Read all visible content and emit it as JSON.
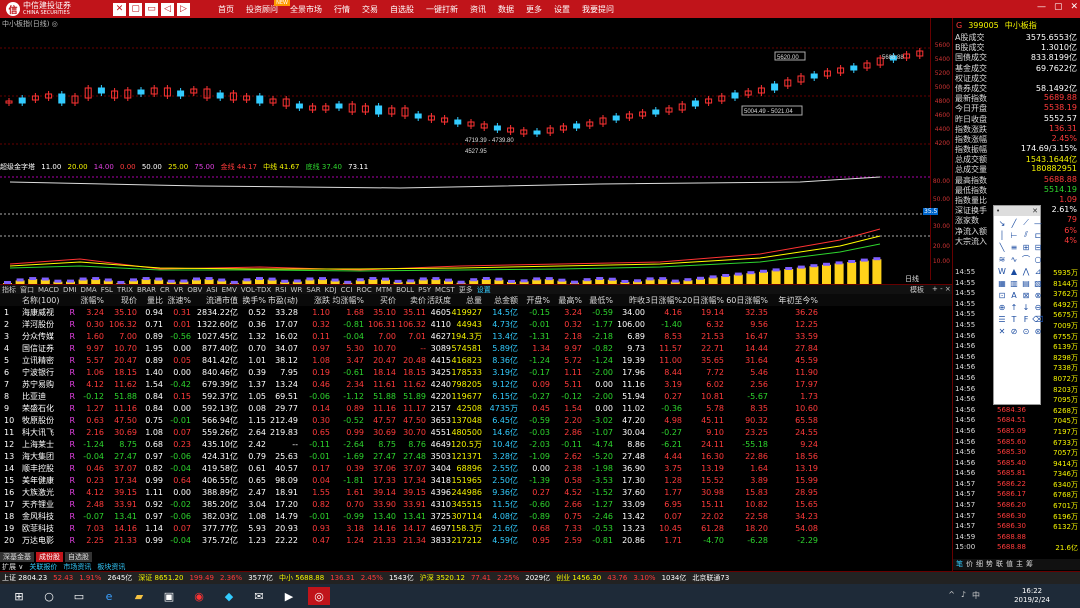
{
  "titlebar": {
    "logo_name": "中信建投证券",
    "logo_sub": "CHINA SECURITIES",
    "win_buttons": [
      "✕",
      "▢",
      "▭",
      "◁",
      "▷"
    ],
    "menu": [
      "首页",
      "投资顾问",
      "全景市场",
      "行情",
      "交易",
      "自选股",
      "一键打新",
      "资讯",
      "数据",
      "更多",
      "设置",
      "我要提问"
    ],
    "menu_new_badge": "NEW",
    "win_ctl": [
      "—",
      "▢",
      "✕"
    ]
  },
  "chart": {
    "kline_title": "中小板指(日线) ◎",
    "price_axis": [
      "5600",
      "5400",
      "5200",
      "5000",
      "4800",
      "4600",
      "4400",
      "4200"
    ],
    "annotations": {
      "high_box": "5620.00",
      "high_right": "5688.88",
      "mid": "5004.49 - 5021.04",
      "low1": "4719.39 - 4739.80",
      "low2": "4527.95"
    },
    "ind_title": "超级金字塔",
    "ind_values": [
      {
        "t": "11.00",
        "c": "white"
      },
      {
        "t": "20.00",
        "c": "yellow"
      },
      {
        "t": "14.00",
        "c": "mag"
      },
      {
        "t": "0.00",
        "c": "red"
      },
      {
        "t": "50.00",
        "c": "white"
      },
      {
        "t": "25.00",
        "c": "yellow"
      },
      {
        "t": "75.00",
        "c": "mag"
      },
      {
        "t": "金线 44.17",
        "c": "red"
      },
      {
        "t": "中线 41.67",
        "c": "yellow"
      },
      {
        "t": "底线 37.40",
        "c": "green"
      },
      {
        "t": "73.11",
        "c": "white"
      }
    ],
    "ind_axis": [
      "80.00",
      "50.00",
      "30.00",
      "35.5",
      "20.00",
      "10.00"
    ],
    "tabs": [
      "指标",
      "窗口",
      "MACD",
      "DMI",
      "DMA",
      "FSL",
      "TRIX",
      "BRAR",
      "CR",
      "VR",
      "OBV",
      "ASI",
      "EMV",
      "VOL-TDX",
      "RSI",
      "WR",
      "SAR",
      "KDJ",
      "CCI",
      "ROC",
      "MTM",
      "BOLL",
      "PSY",
      "MCST",
      "更多",
      "设置"
    ],
    "day_label": "日线",
    "template_label": "模板",
    "close_chars": "+ - ×"
  },
  "table": {
    "headers": [
      "",
      "名称(100)",
      "",
      "涨幅%",
      "现价",
      "量比",
      "涨速%",
      "流通市值",
      "换手%",
      "市盈(动)",
      "涨跌",
      "均涨幅%",
      "买价",
      "卖价",
      "活跃度",
      "总量",
      "总金额",
      "开盘%",
      "最高%",
      "最低%",
      "昨收",
      "3日涨幅%",
      "20日涨幅%",
      "60日涨幅%",
      "年初至今%"
    ],
    "rows": [
      [
        "1",
        "海康威视",
        "R",
        "3.24",
        "35.10",
        "0.94",
        "0.31",
        "2834.22亿",
        "0.52",
        "33.28",
        "1.10",
        "1.68",
        "35.10",
        "35.11",
        "4605",
        "419927",
        "14.5亿",
        "-0.15",
        "3.24",
        "-0.59",
        "34.00",
        "4.16",
        "19.14",
        "32.35",
        "36.26"
      ],
      [
        "2",
        "洋河股份",
        "R",
        "0.30",
        "106.32",
        "0.71",
        "0.01",
        "1322.60亿",
        "0.36",
        "17.07",
        "0.32",
        "-0.81",
        "106.31",
        "106.32",
        "4110",
        "44943",
        "4.73亿",
        "-0.01",
        "0.32",
        "-1.77",
        "106.00",
        "-1.40",
        "6.32",
        "9.56",
        "12.25"
      ],
      [
        "3",
        "分众传媒",
        "R",
        "1.60",
        "7.00",
        "0.89",
        "-0.56",
        "1027.45亿",
        "1.32",
        "16.02",
        "0.11",
        "-0.04",
        "7.00",
        "7.01",
        "4627",
        "194.3万",
        "13.4亿",
        "-1.31",
        "2.18",
        "-2.18",
        "6.89",
        "8.53",
        "21.53",
        "16.47",
        "33.59"
      ],
      [
        "4",
        "国信证券",
        "R",
        "9.97",
        "10.70",
        "1.95",
        "0.00",
        "877.40亿",
        "0.70",
        "34.07",
        "0.97",
        "5.30",
        "10.70",
        "--",
        "3089",
        "574581",
        "5.89亿",
        "1.34",
        "9.97",
        "-0.82",
        "9.73",
        "11.57",
        "22.71",
        "14.44",
        "27.84"
      ],
      [
        "5",
        "立讯精密",
        "R",
        "5.57",
        "20.47",
        "0.89",
        "0.05",
        "841.42亿",
        "1.01",
        "38.12",
        "1.08",
        "3.47",
        "20.47",
        "20.48",
        "4415",
        "416823",
        "8.36亿",
        "-1.24",
        "5.72",
        "-1.24",
        "19.39",
        "11.00",
        "35.65",
        "31.64",
        "45.59"
      ],
      [
        "6",
        "宁波银行",
        "R",
        "1.06",
        "18.15",
        "1.40",
        "0.00",
        "840.46亿",
        "0.39",
        "7.95",
        "0.19",
        "-0.61",
        "18.14",
        "18.15",
        "3425",
        "178533",
        "3.19亿",
        "-0.17",
        "1.11",
        "-2.00",
        "17.96",
        "8.44",
        "7.72",
        "5.46",
        "11.90"
      ],
      [
        "7",
        "苏宁易购",
        "R",
        "4.12",
        "11.62",
        "1.54",
        "-0.42",
        "679.39亿",
        "1.37",
        "13.24",
        "0.46",
        "2.34",
        "11.61",
        "11.62",
        "4240",
        "798205",
        "9.12亿",
        "0.09",
        "5.11",
        "0.00",
        "11.16",
        "3.19",
        "6.02",
        "2.56",
        "17.97"
      ],
      [
        "8",
        "比亚迪",
        "R",
        "-0.12",
        "51.88",
        "0.84",
        "0.15",
        "592.37亿",
        "1.05",
        "69.51",
        "-0.06",
        "-1.12",
        "51.88",
        "51.89",
        "4220",
        "119677",
        "6.15亿",
        "-0.27",
        "-0.12",
        "-2.00",
        "51.94",
        "0.27",
        "10.81",
        "-5.67",
        "1.73"
      ],
      [
        "9",
        "荣盛石化",
        "R",
        "1.27",
        "11.16",
        "0.84",
        "0.00",
        "592.13亿",
        "0.08",
        "29.77",
        "0.14",
        "0.89",
        "11.16",
        "11.17",
        "2157",
        "42508",
        "4735万",
        "0.45",
        "1.54",
        "0.00",
        "11.02",
        "-0.36",
        "5.78",
        "8.35",
        "10.60"
      ],
      [
        "10",
        "牧原股份",
        "R",
        "0.63",
        "47.50",
        "0.75",
        "-0.01",
        "566.94亿",
        "1.15",
        "212.49",
        "0.30",
        "-0.52",
        "47.57",
        "47.50",
        "3653",
        "137048",
        "6.45亿",
        "-0.59",
        "2.20",
        "-3.02",
        "47.20",
        "4.98",
        "45.11",
        "90.32",
        "65.58"
      ],
      [
        "11",
        "科大讯飞",
        "R",
        "2.16",
        "30.69",
        "1.08",
        "0.07",
        "559.26亿",
        "2.64",
        "219.83",
        "0.65",
        "0.99",
        "30.69",
        "30.70",
        "4551",
        "480500",
        "14.6亿",
        "-0.03",
        "2.86",
        "-1.07",
        "30.04",
        "-0.27",
        "9.10",
        "23.25",
        "24.55"
      ],
      [
        "12",
        "上海莱士",
        "R",
        "-1.24",
        "8.75",
        "0.68",
        "0.23",
        "435.10亿",
        "2.42",
        "--",
        "-0.11",
        "-2.64",
        "8.75",
        "8.76",
        "4649",
        "120.5万",
        "10.4亿",
        "-2.03",
        "-0.11",
        "-4.74",
        "8.86",
        "-6.21",
        "24.11",
        "-55.18",
        "9.24"
      ],
      [
        "13",
        "海大集团",
        "R",
        "-0.04",
        "27.47",
        "0.97",
        "-0.06",
        "424.31亿",
        "0.79",
        "25.63",
        "-0.01",
        "-1.69",
        "27.47",
        "27.48",
        "3503",
        "121371",
        "3.28亿",
        "-1.09",
        "2.62",
        "-5.20",
        "27.48",
        "4.44",
        "16.30",
        "22.86",
        "18.56"
      ],
      [
        "14",
        "顺丰控股",
        "R",
        "0.46",
        "37.07",
        "0.82",
        "-0.04",
        "419.58亿",
        "0.61",
        "40.57",
        "0.17",
        "0.39",
        "37.06",
        "37.07",
        "3404",
        "68896",
        "2.55亿",
        "0.00",
        "2.38",
        "-1.98",
        "36.90",
        "3.75",
        "13.19",
        "1.64",
        "13.19"
      ],
      [
        "15",
        "美年健康",
        "R",
        "0.23",
        "17.34",
        "0.99",
        "0.64",
        "406.55亿",
        "0.65",
        "98.09",
        "0.04",
        "-1.81",
        "17.33",
        "17.34",
        "3418",
        "151965",
        "2.50亿",
        "-1.39",
        "0.58",
        "-3.53",
        "17.30",
        "1.28",
        "15.52",
        "3.89",
        "15.99"
      ],
      [
        "16",
        "大族激光",
        "R",
        "4.12",
        "39.15",
        "1.11",
        "0.00",
        "388.89亿",
        "2.47",
        "18.91",
        "1.55",
        "1.61",
        "39.14",
        "39.15",
        "4396",
        "244986",
        "9.36亿",
        "0.27",
        "4.52",
        "-1.52",
        "37.60",
        "1.77",
        "30.98",
        "15.83",
        "28.95"
      ],
      [
        "17",
        "天齐锂业",
        "R",
        "2.48",
        "33.91",
        "0.92",
        "-0.02",
        "385.20亿",
        "3.04",
        "17.20",
        "0.82",
        "0.70",
        "33.90",
        "33.91",
        "4310",
        "345515",
        "11.5亿",
        "-0.60",
        "2.66",
        "-1.27",
        "33.09",
        "6.95",
        "15.11",
        "10.82",
        "15.65"
      ],
      [
        "18",
        "金风科技",
        "R",
        "-0.07",
        "13.41",
        "0.97",
        "-0.06",
        "382.03亿",
        "1.08",
        "14.79",
        "-0.01",
        "-0.99",
        "13.40",
        "13.41",
        "3725",
        "307114",
        "4.08亿",
        "-0.89",
        "0.75",
        "-2.46",
        "13.42",
        "0.07",
        "22.02",
        "22.58",
        "34.23"
      ],
      [
        "19",
        "欧菲科技",
        "R",
        "7.03",
        "14.16",
        "1.14",
        "0.07",
        "377.77亿",
        "5.93",
        "20.93",
        "0.93",
        "3.18",
        "14.16",
        "14.17",
        "4697",
        "158.3万",
        "21.6亿",
        "0.68",
        "7.33",
        "-0.53",
        "13.23",
        "10.45",
        "61.28",
        "18.20",
        "54.08"
      ],
      [
        "20",
        "万达电影",
        "R",
        "2.25",
        "21.33",
        "0.99",
        "-0.04",
        "375.72亿",
        "1.23",
        "22.22",
        "0.47",
        "1.24",
        "21.33",
        "21.34",
        "3833",
        "217212",
        "4.59亿",
        "0.95",
        "2.59",
        "-0.81",
        "20.86",
        "1.71",
        "-4.70",
        "-6.28",
        "-2.29"
      ]
    ]
  },
  "sheet_tabs": [
    "深基金基",
    "成份股",
    "自选股"
  ],
  "links": [
    "扩展 ∨",
    "关联报价",
    "市场资讯",
    "板块资讯"
  ],
  "right": {
    "code": "399005",
    "name": "中小板指",
    "rows": [
      {
        "l": "A股成交",
        "v": "3575.6553亿",
        "c": "white"
      },
      {
        "l": "B股成交",
        "v": "1.3010亿",
        "c": "white"
      },
      {
        "l": "国债成交",
        "v": "833.8199亿",
        "c": "white"
      },
      {
        "l": "基金成交",
        "v": "69.7622亿",
        "c": "white"
      },
      {
        "l": "权证成交",
        "v": "",
        "c": "white"
      },
      {
        "l": "债券成交",
        "v": "58.1492亿",
        "c": "white"
      },
      {
        "l": "最新指数",
        "v": "5689.88",
        "c": "red"
      },
      {
        "l": "今日开盘",
        "v": "5538.19",
        "c": "red"
      },
      {
        "l": "昨日收盘",
        "v": "5552.57",
        "c": "white"
      },
      {
        "l": "指数涨跌",
        "v": "136.31",
        "c": "red"
      },
      {
        "l": "指数涨幅",
        "v": "2.45%",
        "c": "red"
      },
      {
        "l": "指数振幅",
        "v": "174.69/3.15%",
        "c": "white"
      },
      {
        "l": "总成交额",
        "v": "1543.1644亿",
        "c": "yellow"
      },
      {
        "l": "总成交量",
        "v": "180882951",
        "c": "yellow"
      },
      {
        "l": "最高指数",
        "v": "5688.88",
        "c": "red"
      },
      {
        "l": "最低指数",
        "v": "5514.19",
        "c": "green"
      },
      {
        "l": "指数量比",
        "v": "1.09",
        "c": "red"
      },
      {
        "l": "深证换手",
        "v": "2.61%",
        "c": "white"
      },
      {
        "l": "涨家数",
        "v": "79",
        "c": "red"
      },
      {
        "l": "净流入额",
        "v": "6%",
        "c": "red"
      },
      {
        "l": "大宗流入",
        "v": "4%",
        "c": "red"
      }
    ],
    "ticks": [
      [
        "14:55",
        "5684.65",
        "5935万"
      ],
      [
        "14:55",
        "5684.71",
        "8144万"
      ],
      [
        "14:55",
        "5685.19",
        "3762万"
      ],
      [
        "14:55",
        "5685.29",
        "6492万"
      ],
      [
        "14:55",
        "5685.55",
        "5675万"
      ],
      [
        "14:55",
        "5685.62",
        "7009万"
      ],
      [
        "14:56",
        "5685.68",
        "6755万"
      ],
      [
        "14:56",
        "5685.72",
        "6139万"
      ],
      [
        "14:56",
        "5685.79",
        "8298万"
      ],
      [
        "14:56",
        "5685.34",
        "7338万"
      ],
      [
        "14:56",
        "5685.32",
        "8072万"
      ],
      [
        "14:56",
        "5685.55",
        "8203万"
      ],
      [
        "14:56",
        "5685.31",
        "7095万"
      ],
      [
        "14:56",
        "5684.36",
        "6268万"
      ],
      [
        "14:56",
        "5684.51",
        "7045万"
      ],
      [
        "14:56",
        "5685.09",
        "7197万"
      ],
      [
        "14:56",
        "5685.60",
        "6733万"
      ],
      [
        "14:56",
        "5685.30",
        "7057万"
      ],
      [
        "14:56",
        "5685.40",
        "9414万"
      ],
      [
        "14:56",
        "5685.81",
        "7346万"
      ],
      [
        "14:57",
        "5686.22",
        "6340万"
      ],
      [
        "14:57",
        "5686.17",
        "6768万"
      ],
      [
        "14:57",
        "5686.20",
        "6701万"
      ],
      [
        "14:57",
        "5686.30",
        "6196万"
      ],
      [
        "14:57",
        "5686.30",
        "6132万"
      ],
      [
        "14:59",
        "5688.88",
        ""
      ],
      [
        "15:00",
        "5688.88",
        "21.6亿"
      ]
    ],
    "bottom_tabs": [
      "笔",
      "价",
      "细",
      "势",
      "联",
      "值",
      "主",
      "筹"
    ]
  },
  "statusbar": [
    {
      "t": "上证 2804.23",
      "c": "white"
    },
    {
      "t": "52.43",
      "c": "red"
    },
    {
      "t": "1.91%",
      "c": "red"
    },
    {
      "t": "2645亿",
      "c": "white"
    },
    {
      "t": "深证 8651.20",
      "c": "yellow"
    },
    {
      "t": "199.49",
      "c": "red"
    },
    {
      "t": "2.36%",
      "c": "red"
    },
    {
      "t": "3577亿",
      "c": "white"
    },
    {
      "t": "中小 5688.88",
      "c": "yellow"
    },
    {
      "t": "136.31",
      "c": "red"
    },
    {
      "t": "2.45%",
      "c": "red"
    },
    {
      "t": "1543亿",
      "c": "white"
    },
    {
      "t": "沪深 3520.12",
      "c": "yellow"
    },
    {
      "t": "77.41",
      "c": "red"
    },
    {
      "t": "2.25%",
      "c": "red"
    },
    {
      "t": "2029亿",
      "c": "white"
    },
    {
      "t": "创业 1456.30",
      "c": "yellow"
    },
    {
      "t": "43.76",
      "c": "red"
    },
    {
      "t": "3.10%",
      "c": "red"
    },
    {
      "t": "1034亿",
      "c": "white"
    },
    {
      "t": "北京联通73",
      "c": "white"
    }
  ],
  "taskbar": {
    "time": "16:22",
    "date": "2019/2/24",
    "tray": [
      "^",
      "♪",
      "中"
    ]
  }
}
